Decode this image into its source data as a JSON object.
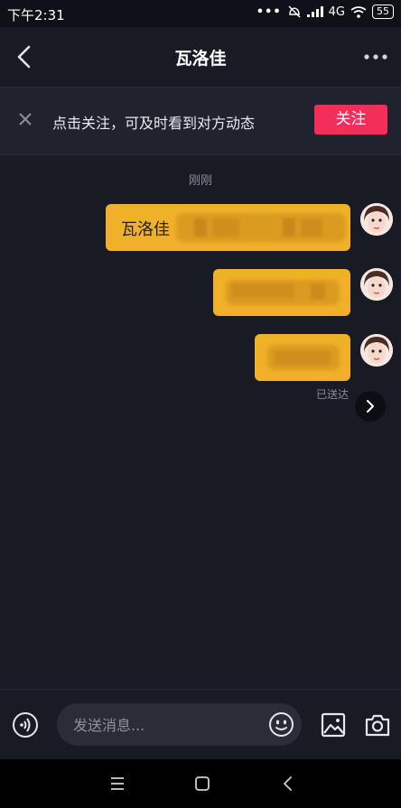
{
  "status_bar": {
    "time": "下午2:31",
    "network": "4G",
    "battery": "55"
  },
  "header": {
    "title": "瓦洛佳",
    "back_icon": "chevron-left-icon",
    "more_icon": "more-dots-icon"
  },
  "follow_bar": {
    "text": "点击关注，可及时看到对方动态",
    "button_label": "关注",
    "button_color": "#f32e58"
  },
  "chat": {
    "timestamp": "刚刚",
    "messages": [
      {
        "text": "瓦洛佳",
        "blurred": true
      },
      {
        "text": "",
        "blurred": true
      },
      {
        "text": "",
        "blurred": true
      }
    ],
    "delivered_label": "已送达",
    "bubble_color": "#f0b029"
  },
  "input": {
    "placeholder": "发送消息..."
  }
}
